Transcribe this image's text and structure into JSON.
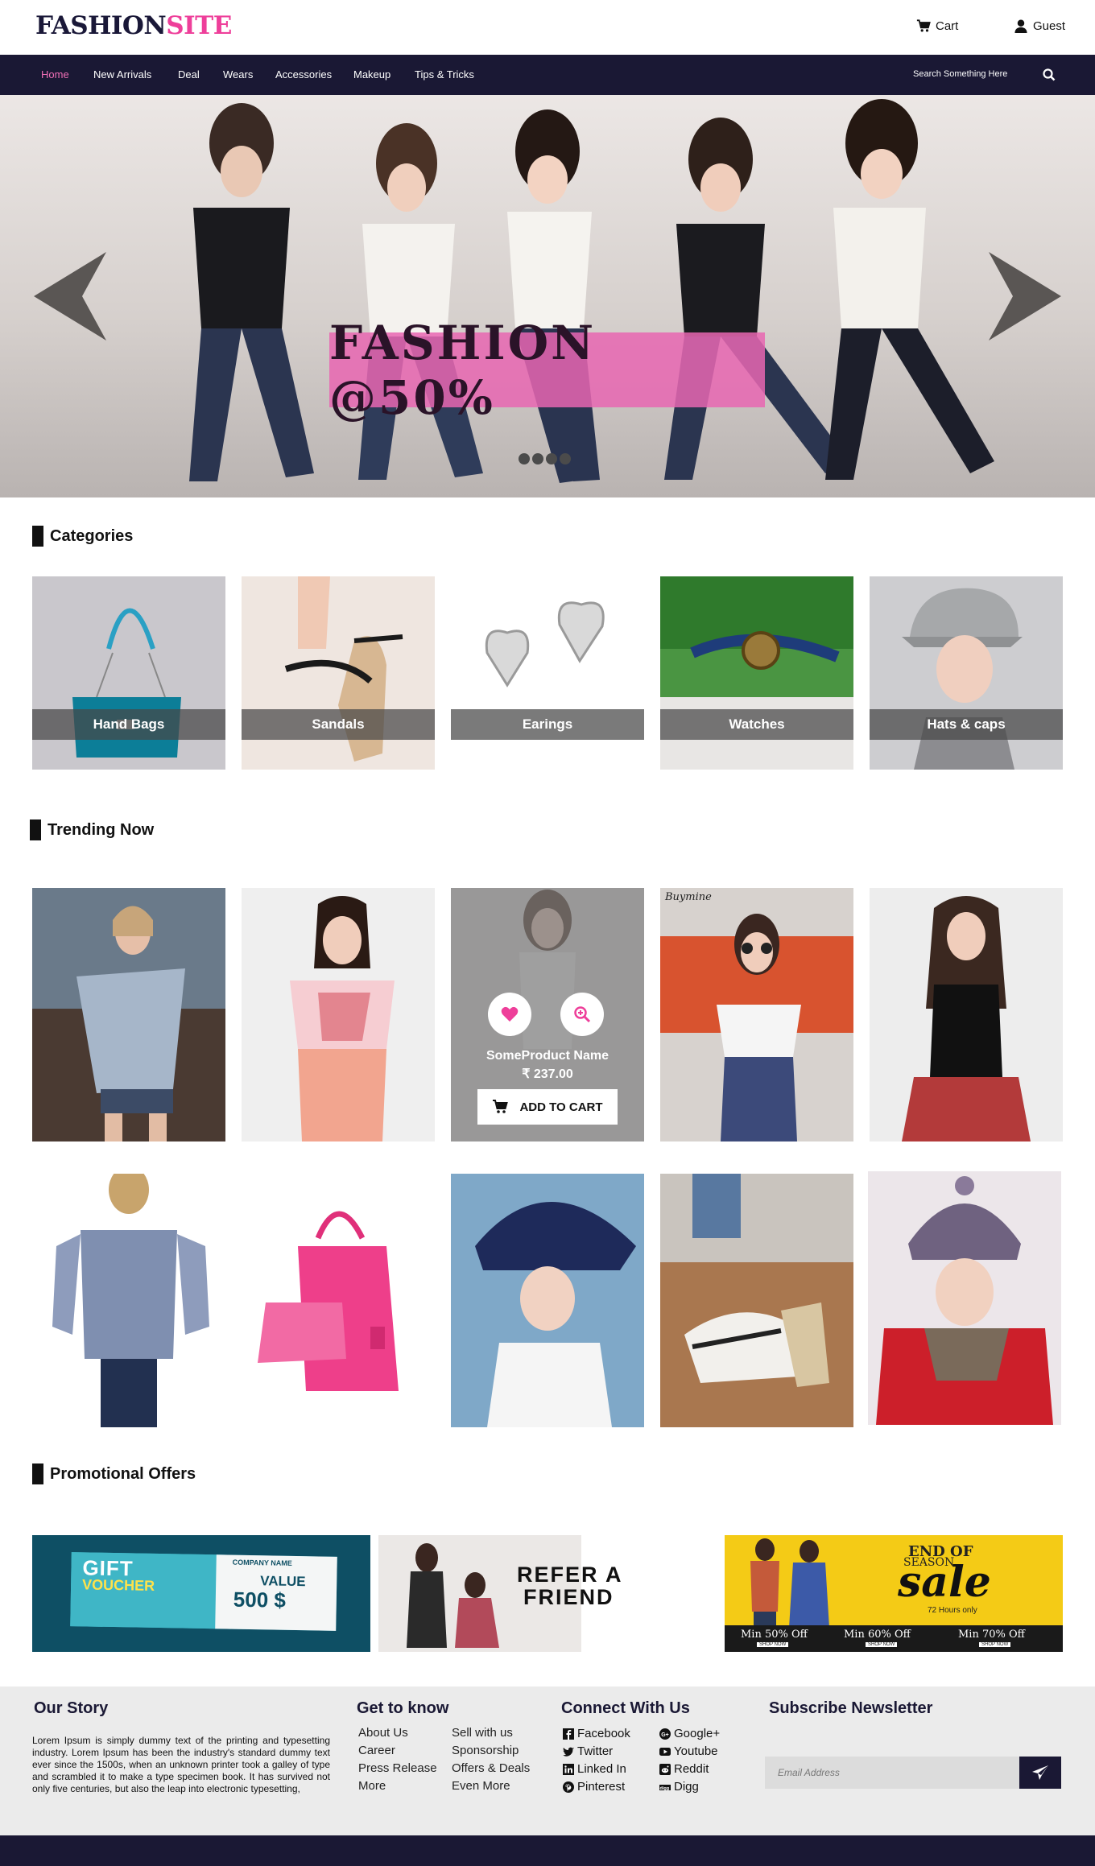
{
  "brand": {
    "part1": "FASHION",
    "part2": "SITE",
    "colors": {
      "navy": "#1a1834",
      "pink": "#ee3f9a"
    }
  },
  "header": {
    "cart_label": "Cart",
    "cart_icon": "cart-icon",
    "guest_label": "Guest",
    "guest_icon": "user-icon"
  },
  "nav": {
    "items": [
      "Home",
      "New Arrivals",
      "Deal",
      "Wears",
      "Accessories",
      "Makeup",
      "Tips & Tricks"
    ],
    "active": "Home",
    "search_text": "Search Something Here",
    "search_icon": "search-icon"
  },
  "hero": {
    "banner_text": "FASHION @50%",
    "prev_icon": "chevron-left-icon",
    "next_icon": "chevron-right-icon",
    "slide_count": 4
  },
  "categories": {
    "title": "Categories",
    "items": [
      "Hand Bags",
      "Sandals",
      "Earings",
      "Watches",
      "Hats & caps"
    ]
  },
  "trending": {
    "title": "Trending Now",
    "featured": {
      "name": "SomeProduct Name",
      "price": "₹ 237.00",
      "add_to_cart": "ADD TO CART"
    },
    "watermark": "Buymine"
  },
  "promotions": {
    "title": "Promotional Offers",
    "gift": {
      "line1": "GIFT",
      "line2": "VOUCHER",
      "company": "COMPANY NAME",
      "value_label": "VALUE",
      "value": "500 $"
    },
    "refer": {
      "line1": "REFER A",
      "line2": "FRIEND"
    },
    "sale": {
      "line1": "END OF",
      "line2": "SEASON",
      "line3": "sale",
      "line4": "72 Hours only",
      "offers": [
        "Min 50% Off",
        "Min 60% Off",
        "Min 70% Off"
      ],
      "shop_now": "SHOP NOW"
    }
  },
  "footer": {
    "story_title": "Our Story",
    "story_text": "Lorem Ipsum is simply dummy text of the printing and typesetting industry. Lorem Ipsum has been the industry's standard dummy text ever since the 1500s, when an unknown printer took a galley of type and scrambled it to make a type specimen book. It has survived not only five centuries, but also the leap into electronic typesetting,",
    "know_title": "Get to know",
    "know_col1": [
      "About Us",
      "Career",
      "Press Release",
      "More"
    ],
    "know_col2": [
      "Sell with us",
      "Sponsorship",
      "Offers & Deals",
      "Even More"
    ],
    "connect_title": "Connect With Us",
    "social_col1": [
      "Facebook",
      "Twitter",
      "Linked In",
      "Pinterest"
    ],
    "social_col2": [
      "Google+",
      "Youtube",
      "Reddit",
      "Digg"
    ],
    "newsletter_title": "Subscribe Newsletter",
    "email_placeholder": "Email Address",
    "send_icon": "send-icon"
  }
}
